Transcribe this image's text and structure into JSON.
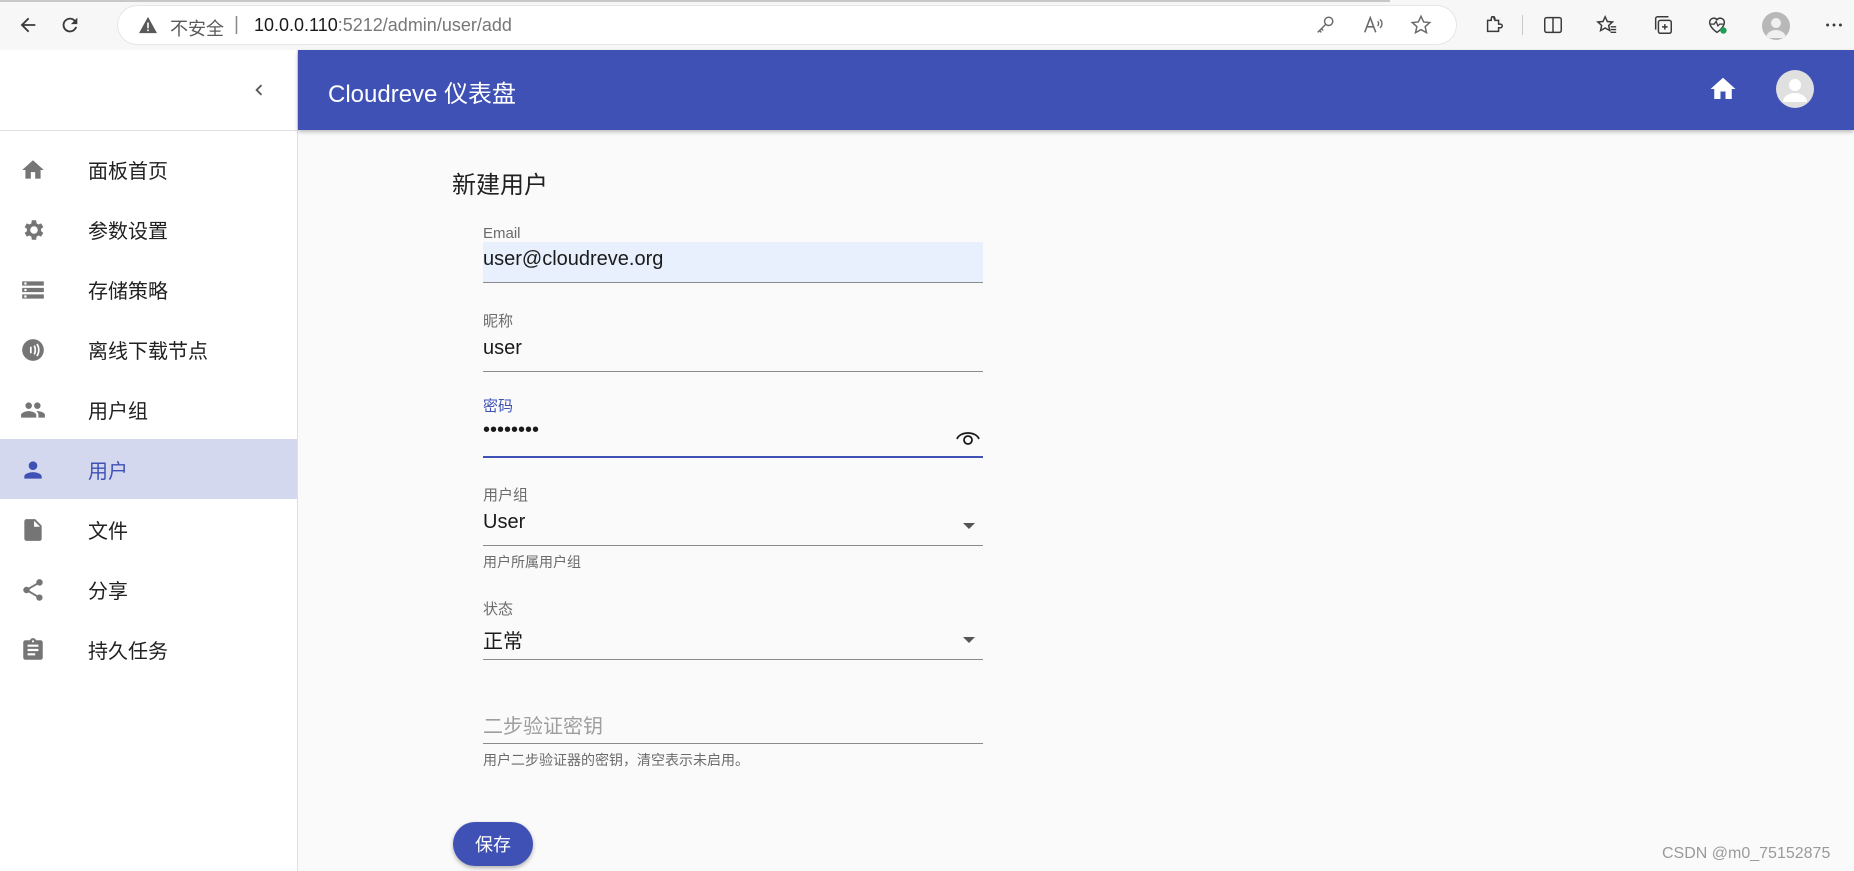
{
  "browser": {
    "insecure_label": "不安全",
    "separator": "|",
    "url_host": "10.0.0.110",
    "url_rest": ":5212/admin/user/add"
  },
  "app": {
    "title": "Cloudreve 仪表盘"
  },
  "sidebar": {
    "items": [
      {
        "label": "面板首页",
        "icon": "home-icon"
      },
      {
        "label": "参数设置",
        "icon": "settings-icon"
      },
      {
        "label": "存储策略",
        "icon": "storage-icon"
      },
      {
        "label": "离线下载节点",
        "icon": "download-node-icon"
      },
      {
        "label": "用户组",
        "icon": "group-icon"
      },
      {
        "label": "用户",
        "icon": "person-icon",
        "active": true
      },
      {
        "label": "文件",
        "icon": "file-icon"
      },
      {
        "label": "分享",
        "icon": "share-icon"
      },
      {
        "label": "持久任务",
        "icon": "task-icon"
      }
    ]
  },
  "form": {
    "heading": "新建用户",
    "email": {
      "label": "Email",
      "value": "user@cloudreve.org"
    },
    "nickname": {
      "label": "昵称",
      "value": "user"
    },
    "password": {
      "label": "密码",
      "value": "••••••••"
    },
    "group": {
      "label": "用户组",
      "value": "User",
      "helper": "用户所属用户组"
    },
    "status": {
      "label": "状态",
      "value": "正常"
    },
    "two_factor": {
      "placeholder": "二步验证密钥",
      "helper": "用户二步验证器的密钥，清空表示未启用。"
    },
    "save_label": "保存"
  },
  "watermark": "CSDN @m0_75152875",
  "colors": {
    "primary": "#3f51b5",
    "active_bg": "#d4d8ee",
    "autofill_bg": "#e8f0fe"
  }
}
